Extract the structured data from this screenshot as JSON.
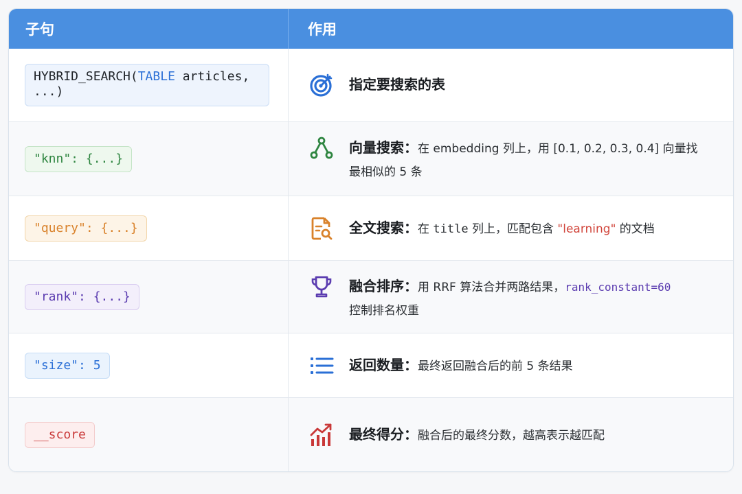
{
  "header": {
    "col1": "子句",
    "col2": "作用"
  },
  "rows": [
    {
      "clause_kw": "TABLE",
      "clause_pre": "HYBRID_SEARCH(",
      "clause_post": " articles,",
      "clause_line2": "...)",
      "icon": "target-icon",
      "label": "指定要搜索的表"
    },
    {
      "clause": "\"knn\": {...}",
      "icon": "graph-nodes-icon",
      "label": "向量搜索：",
      "text1": "在 embedding 列上，用 [0.1, 0.2, 0.3, 0.4] 向量找",
      "text2": "最相似的 5 条"
    },
    {
      "clause": "\"query\": {...}",
      "icon": "document-search-icon",
      "label": "全文搜索：",
      "text_a": "在 ",
      "text_mono": "title",
      "text_b": " 列上，匹配包含 ",
      "text_red": "\"learning\"",
      "text_c": " 的文档"
    },
    {
      "clause": "\"rank\": {...}",
      "icon": "trophy-icon",
      "label": "融合排序：",
      "text_a": "用 RRF 算法合并两路结果，",
      "text_mono": "rank_constant=60",
      "text2": "控制排名权重"
    },
    {
      "clause": "\"size\": 5",
      "icon": "list-icon",
      "label": "返回数量：",
      "text1": "最终返回融合后的前 5 条结果"
    },
    {
      "clause": "__score",
      "icon": "chart-up-icon",
      "label": "最终得分：",
      "text1": "融合后的最终分数，越高表示越匹配"
    }
  ],
  "colors": {
    "header": "#4a8fe0",
    "blue": "#2a6fd6",
    "green": "#2e8540",
    "orange": "#d9822b",
    "purple": "#5b3cb0",
    "red": "#c93838"
  }
}
